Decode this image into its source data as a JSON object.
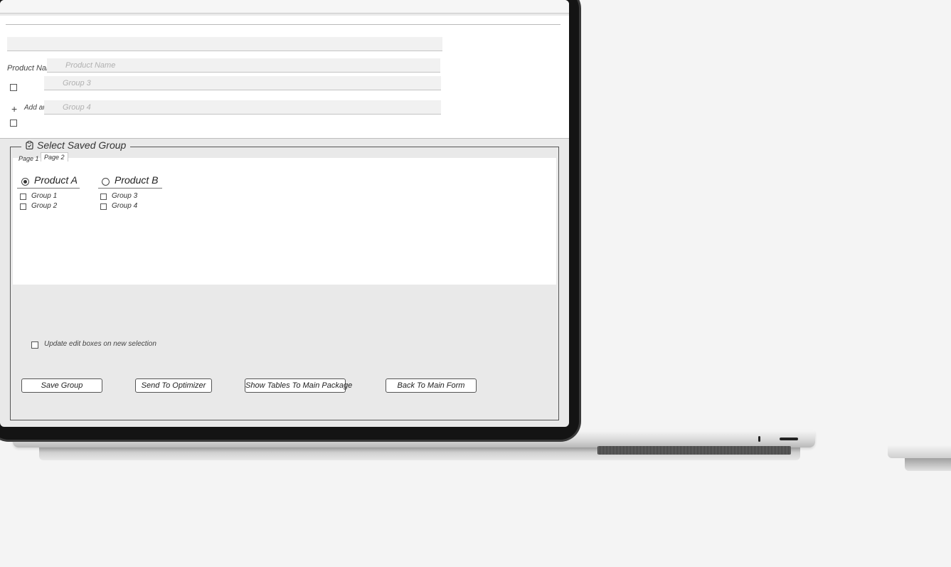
{
  "form": {
    "product_name_label": "Product Name:",
    "product_name_placeholder": "Product Name",
    "group3_placeholder": "Group 3",
    "add_group_label": "Add another group",
    "group4_placeholder": "Group 4"
  },
  "saved_group": {
    "title": "Select Saved Group",
    "tabs": [
      {
        "label": "Page 1",
        "active": false
      },
      {
        "label": "Page 2",
        "active": true
      }
    ],
    "products": [
      {
        "name": "Product A",
        "selected": true,
        "groups": [
          "Group 1",
          "Group 2"
        ]
      },
      {
        "name": "Product B",
        "selected": false,
        "groups": [
          "Group 3",
          "Group 4"
        ]
      }
    ]
  },
  "options": {
    "update_checkbox_label": "Update edit boxes on new selection"
  },
  "buttons": {
    "save": "Save Group",
    "send": "Send To Optimizer",
    "show_tables": "Show Tables To Main Package",
    "back": "Back To Main Form"
  }
}
